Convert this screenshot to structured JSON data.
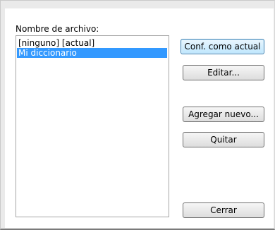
{
  "file_label": "Nombre de archivo:",
  "list": {
    "items": [
      {
        "text": "[ninguno] [actual]",
        "selected": false
      },
      {
        "text": "Mi diccionario",
        "selected": true
      }
    ]
  },
  "buttons": {
    "set_current": "Conf. como actual",
    "edit": "Editar...",
    "add_new": "Agregar nuevo...",
    "remove": "Quitar",
    "close": "Cerrar"
  },
  "colors": {
    "selection": "#3399ff",
    "default_button_border": "#3c7fb1"
  }
}
